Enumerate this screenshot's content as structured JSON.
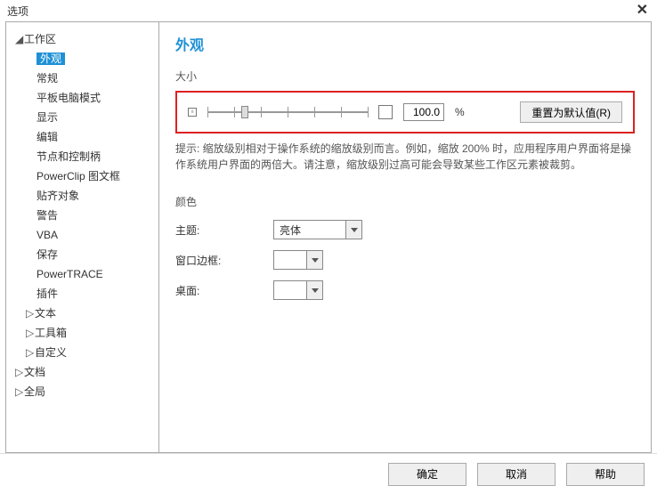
{
  "window": {
    "title": "选项",
    "close": "✕"
  },
  "sidebar": {
    "items": [
      {
        "label": "工作区",
        "level": 0,
        "expanded": true
      },
      {
        "label": "外观",
        "level": 1,
        "selected": true
      },
      {
        "label": "常规",
        "level": 1
      },
      {
        "label": "平板电脑模式",
        "level": 1
      },
      {
        "label": "显示",
        "level": 1
      },
      {
        "label": "编辑",
        "level": 1
      },
      {
        "label": "节点和控制柄",
        "level": 1
      },
      {
        "label": "PowerClip 图文框",
        "level": 1
      },
      {
        "label": "贴齐对象",
        "level": 1
      },
      {
        "label": "警告",
        "level": 1
      },
      {
        "label": "VBA",
        "level": 1
      },
      {
        "label": "保存",
        "level": 1
      },
      {
        "label": "PowerTRACE",
        "level": 1
      },
      {
        "label": "插件",
        "level": 1
      },
      {
        "label": "文本",
        "level": 1,
        "expander": "▷"
      },
      {
        "label": "工具箱",
        "level": 1,
        "expander": "▷"
      },
      {
        "label": "自定义",
        "level": 1,
        "expander": "▷"
      },
      {
        "label": "文档",
        "level": 0,
        "expander": "▷"
      },
      {
        "label": "全局",
        "level": 0,
        "expander": "▷"
      }
    ]
  },
  "main": {
    "heading": "外观",
    "size_label": "大小",
    "scale_value": "100.0",
    "percent": "%",
    "reset_label": "重置为默认值(R)",
    "hint": "提示: 缩放级别相对于操作系统的缩放级别而言。例如，缩放 200% 时，应用程序用户界面将是操作系统用户界面的两倍大。请注意，缩放级别过高可能会导致某些工作区元素被裁剪。",
    "color_label": "颜色",
    "theme_label": "主题:",
    "theme_value": "亮体",
    "border_label": "窗口边框:",
    "desktop_label": "桌面:"
  },
  "footer": {
    "ok": "确定",
    "cancel": "取消",
    "help": "帮助"
  }
}
